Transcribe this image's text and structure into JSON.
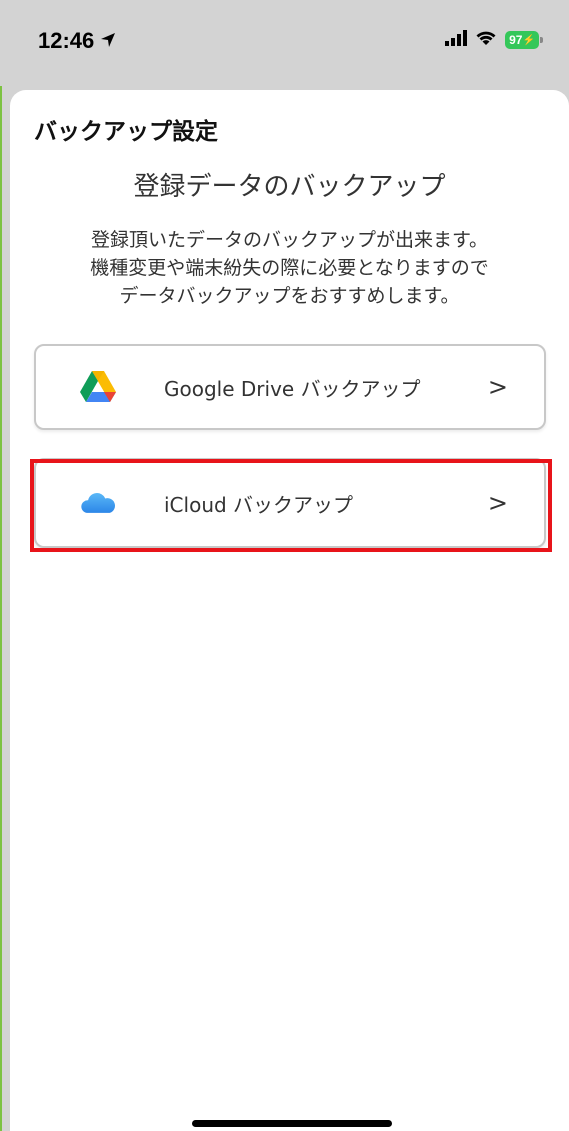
{
  "status": {
    "time": "12:46",
    "battery": "97"
  },
  "sheet": {
    "title": "バックアップ設定",
    "subtitle": "登録データのバックアップ",
    "description": [
      "登録頂いたデータのバックアップが出来ます。",
      "機種変更や端末紛失の際に必要となりますので",
      "データバックアップをおすすめします。"
    ]
  },
  "options": [
    {
      "label": "Google Drive バックアップ",
      "icon": "google-drive-icon",
      "chevron": ">"
    },
    {
      "label": "iCloud バックアップ",
      "icon": "icloud-icon",
      "chevron": ">"
    }
  ],
  "colors": {
    "highlight": "#e8141a",
    "battery": "#34c759",
    "icloud": "#3b9cf0"
  }
}
